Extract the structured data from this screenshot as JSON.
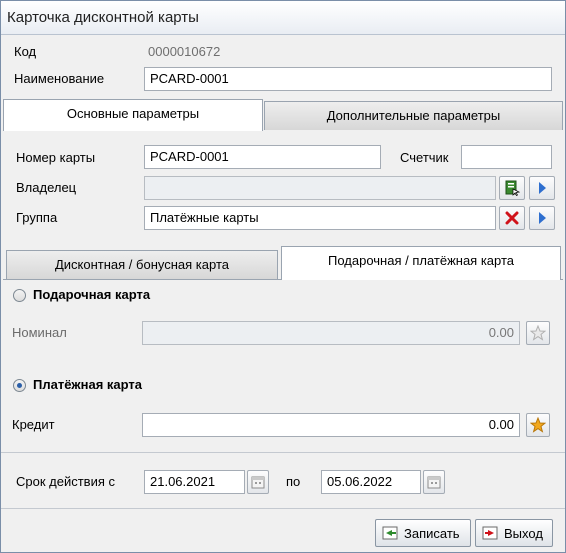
{
  "window": {
    "title": "Карточка дисконтной карты"
  },
  "header": {
    "code_label": "Код",
    "code_value": "0000010672",
    "name_label": "Наименование",
    "name_value": "PCARD-0001"
  },
  "main_tabs": [
    {
      "label": "Основные параметры",
      "active": true
    },
    {
      "label": "Дополнительные параметры",
      "active": false
    }
  ],
  "main": {
    "card_number_label": "Номер карты",
    "card_number_value": "PCARD-0001",
    "counter_label": "Счетчик",
    "counter_value": "",
    "owner_label": "Владелец",
    "owner_value": "",
    "group_label": "Группа",
    "group_value": "Платёжные карты"
  },
  "card_tabs": [
    {
      "label": "Дисконтная / бонусная карта",
      "active": false
    },
    {
      "label": "Подарочная / платёжная карта",
      "active": true
    }
  ],
  "gift": {
    "radio_label": "Подарочная карта",
    "selected": false,
    "nominal_label": "Номинал",
    "nominal_value": "0.00"
  },
  "payment": {
    "radio_label": "Платёжная карта",
    "selected": true,
    "credit_label": "Кредит",
    "credit_value": "0.00"
  },
  "validity": {
    "from_label": "Срок действия с",
    "from_value": "21.06.2021",
    "to_label": "по",
    "to_value": "05.06.2022"
  },
  "footer": {
    "save_label": "Записать",
    "exit_label": "Выход"
  },
  "icons": {
    "select": "select-icon",
    "arrow": "arrow-right-icon",
    "clear": "clear-x-icon",
    "star": "star-icon",
    "calendar": "calendar-icon",
    "save": "save-icon",
    "exit": "exit-icon"
  },
  "colors": {
    "accent_blue": "#2f6fcf",
    "clear_red": "#d0121a",
    "star_gold": "#f2a81d"
  }
}
